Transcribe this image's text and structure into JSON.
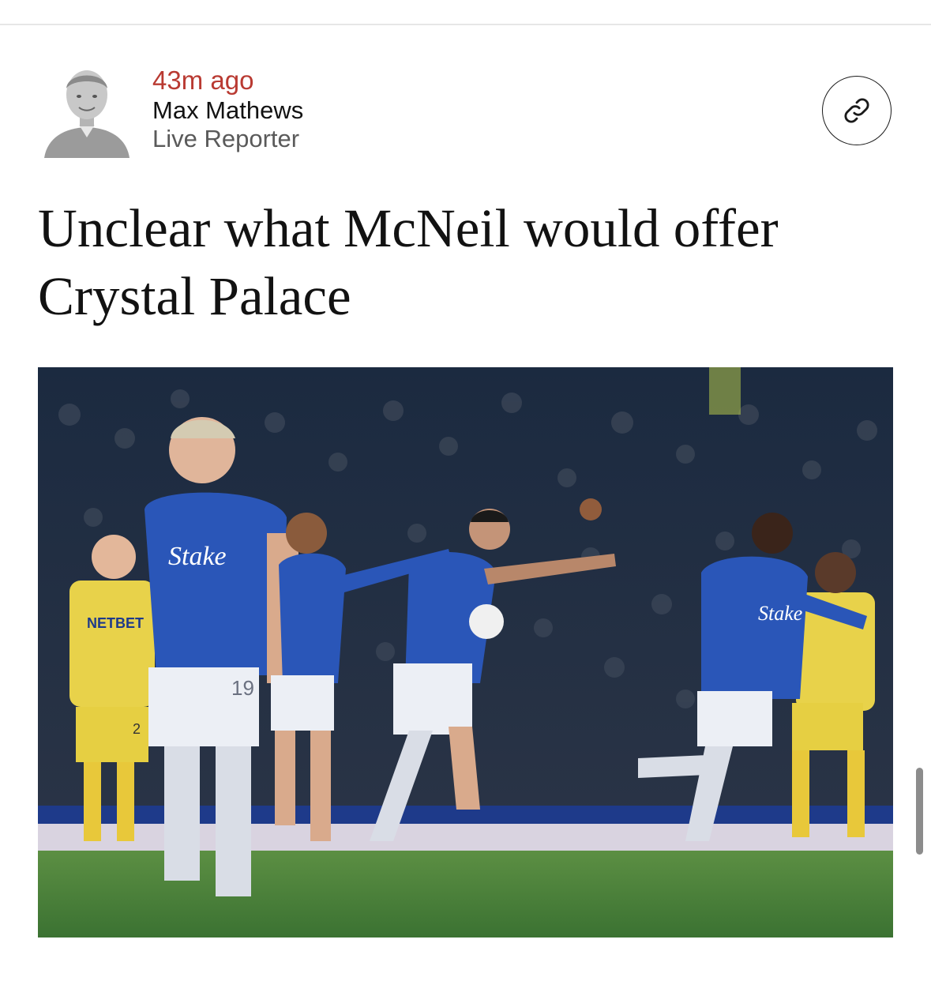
{
  "post": {
    "timestamp": "43m ago",
    "author_name": "Max Mathews",
    "author_role": "Live Reporter",
    "share_icon": "link-icon",
    "headline": "Unclear what McNeil would offer Crystal Palace"
  },
  "photo": {
    "kit_sponsor": "Stake",
    "palace_sponsor": "NETBET",
    "shirt_number": "19",
    "palace_number": "2"
  },
  "colors": {
    "timestamp": "#b93a32",
    "text": "#121212",
    "secondary_text": "#5a5a5a",
    "everton_blue": "#1f4fae",
    "palace_yellow": "#e8d24a",
    "pitch": "#3f7d3a"
  }
}
